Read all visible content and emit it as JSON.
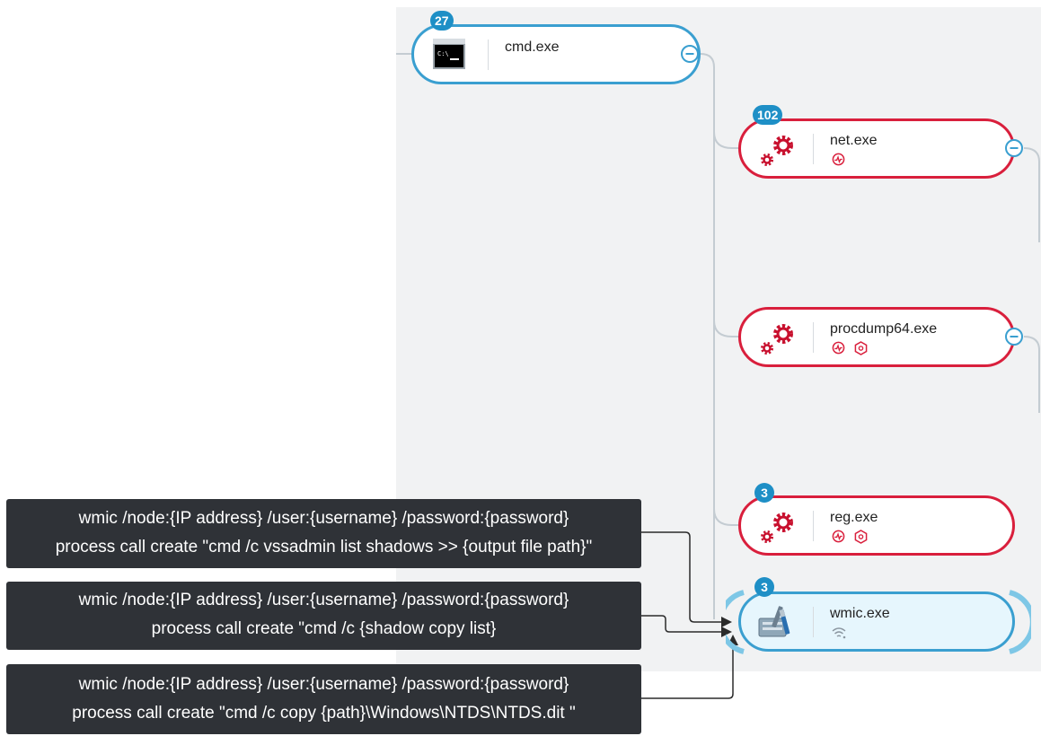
{
  "nodes": {
    "cmd": {
      "label": "cmd.exe",
      "count": "27",
      "icon": "cmd-console-icon"
    },
    "net": {
      "label": "net.exe",
      "count": "102",
      "icon": "gears-icon",
      "badges": [
        "activity-icon"
      ]
    },
    "procdump": {
      "label": "procdump64.exe",
      "icon": "gears-icon",
      "badges": [
        "activity-icon",
        "hexagon-alert-icon"
      ]
    },
    "reg": {
      "label": "reg.exe",
      "count": "3",
      "icon": "gears-icon",
      "badges": [
        "activity-icon",
        "hexagon-alert-icon"
      ]
    },
    "wmic": {
      "label": "wmic.exe",
      "count": "3",
      "icon": "wmic-tools-icon",
      "badges": [
        "network-icon"
      ]
    }
  },
  "annotations": [
    {
      "line1": "wmic /node:{IP address} /user:{username} /password:{password}",
      "line2": "process call create \"cmd /c vssadmin list shadows >> {output file path}\""
    },
    {
      "line1": "wmic /node:{IP address} /user:{username} /password:{password}",
      "line2": "process call create \"cmd /c {shadow copy list}"
    },
    {
      "line1": "wmic /node:{IP address} /user:{username} /password:{password}",
      "line2": "process call create \"cmd /c copy {path}\\Windows\\NTDS\\NTDS.dit \""
    }
  ],
  "colors": {
    "panel": "#f1f2f3",
    "blue_accent": "#3a9fd0",
    "red_alert": "#d91f3c",
    "badge_blue": "#1e8fc6",
    "annotation_bg": "#2f3237",
    "selected_fill": "#e6f6fd"
  }
}
